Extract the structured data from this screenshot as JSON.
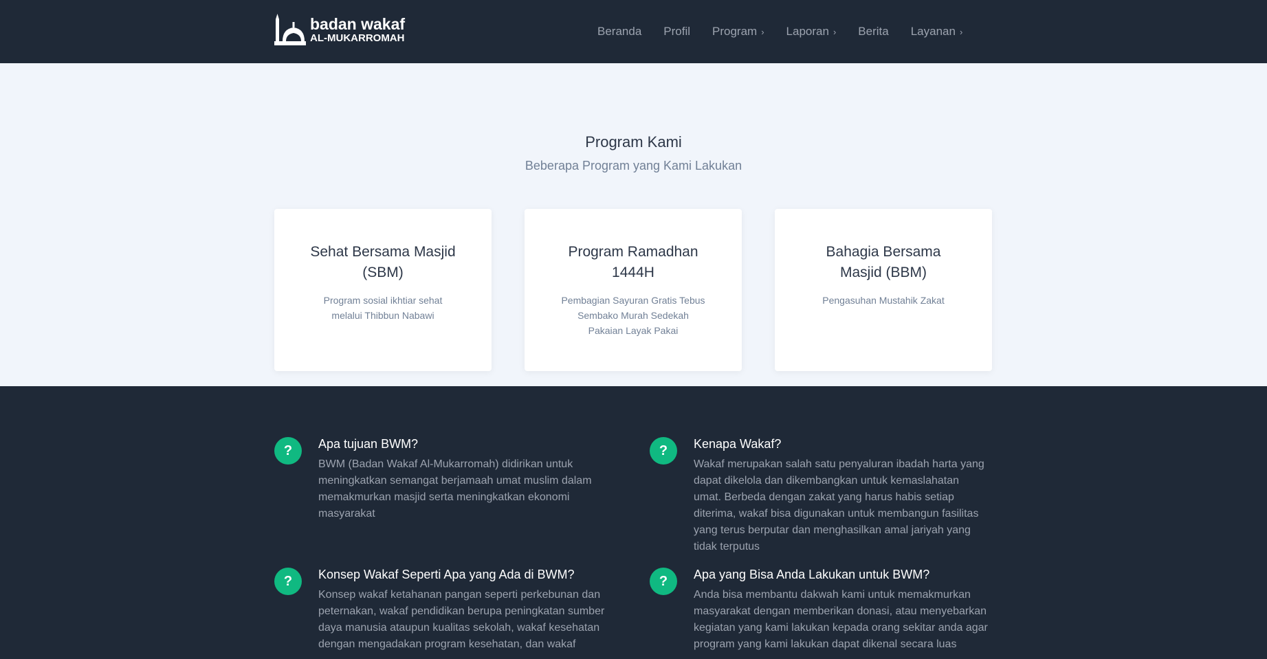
{
  "header": {
    "logo": {
      "line1": "badan wakaf",
      "line2": "AL-MUKARROMAH"
    },
    "nav": [
      {
        "label": "Beranda",
        "dropdown": false
      },
      {
        "label": "Profil",
        "dropdown": false
      },
      {
        "label": "Program",
        "dropdown": true
      },
      {
        "label": "Laporan",
        "dropdown": true
      },
      {
        "label": "Berita",
        "dropdown": false
      },
      {
        "label": "Layanan",
        "dropdown": true
      }
    ]
  },
  "programs": {
    "title": "Program Kami",
    "subtitle": "Beberapa Program yang Kami Lakukan",
    "cards": [
      {
        "title": "Sehat Bersama Masjid (SBM)",
        "desc": "Program sosial ikhtiar sehat melalui Thibbun Nabawi"
      },
      {
        "title": "Program Ramadhan 1444H",
        "desc": "Pembagian Sayuran Gratis Tebus Sembako Murah Sedekah Pakaian Layak Pakai"
      },
      {
        "title": "Bahagia Bersama Masjid (BBM)",
        "desc": "Pengasuhan Mustahik Zakat"
      }
    ]
  },
  "faq": [
    {
      "q": "Apa tujuan BWM?",
      "a": "BWM (Badan Wakaf Al-Mukarromah) didirikan untuk meningkatkan semangat berjamaah umat muslim dalam memakmurkan masjid serta meningkatkan ekonomi masyarakat"
    },
    {
      "q": "Kenapa Wakaf?",
      "a": "Wakaf merupakan salah satu penyaluran ibadah harta yang dapat dikelola dan dikembangkan untuk kemaslahatan umat. Berbeda dengan zakat yang harus habis setiap diterima, wakaf bisa digunakan untuk membangun fasilitas yang terus berputar dan menghasilkan amal jariyah yang tidak terputus"
    },
    {
      "q": "Konsep Wakaf Seperti Apa yang Ada di BWM?",
      "a": "Konsep wakaf ketahanan pangan seperti perkebunan dan peternakan, wakaf pendidikan berupa peningkatan sumber daya manusia ataupun kualitas sekolah, wakaf kesehatan dengan mengadakan program kesehatan, dan wakaf"
    },
    {
      "q": "Apa yang Bisa Anda Lakukan untuk BWM?",
      "a": "Anda bisa membantu dakwah kami untuk memakmurkan masyarakat dengan memberikan donasi, atau menyebarkan kegiatan yang kami lakukan kepada orang sekitar anda agar program yang kami lakukan dapat dikenal secara luas"
    }
  ],
  "colors": {
    "dark": "#1f2937",
    "light": "#f1f5fb",
    "accent": "#10b981"
  },
  "icons": {
    "faq": "question-circle-icon",
    "logo": "mosque-icon",
    "dropdown": "chevron-down-icon"
  }
}
